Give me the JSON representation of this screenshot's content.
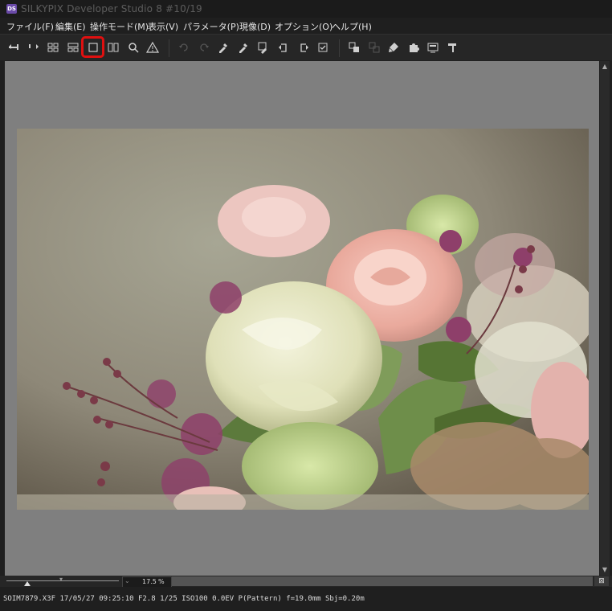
{
  "window": {
    "app_icon_label": "DS",
    "title": "SILKYPIX Developer Studio 8   #10/19"
  },
  "menu": [
    {
      "label": "ファイル(F)"
    },
    {
      "label": "編集(E)"
    },
    {
      "label": "操作モード(M)"
    },
    {
      "label": "表示(V)"
    },
    {
      "label": "パラメータ(P)"
    },
    {
      "label": "現像(D)"
    },
    {
      "label": "オプション(O)"
    },
    {
      "label": "ヘルプ(H)"
    }
  ],
  "toolbar": {
    "highlighted_tool": "single-image-view-button",
    "tools": [
      {
        "name": "prev-image-button",
        "icon": "arrow-left-icon"
      },
      {
        "name": "next-image-button",
        "icon": "arrow-right-icon"
      },
      {
        "name": "thumbnail-view-button",
        "icon": "grid-icon"
      },
      {
        "name": "thumbnail-list-button",
        "icon": "list-grid-icon"
      },
      {
        "name": "single-image-view-button",
        "icon": "single-frame-icon"
      },
      {
        "name": "compare-view-button",
        "icon": "dual-frame-icon"
      },
      {
        "name": "zoom-button",
        "icon": "magnifier-icon"
      },
      {
        "name": "highlight-warning-button",
        "icon": "warning-icon"
      },
      {
        "name": "undo-button",
        "icon": "undo-icon"
      },
      {
        "name": "redo-button",
        "icon": "redo-icon"
      },
      {
        "name": "white-balance-dropper-button",
        "icon": "dropper-icon"
      },
      {
        "name": "gray-balance-dropper-button",
        "icon": "dropper-icon"
      },
      {
        "name": "skin-dropper-button",
        "icon": "dropper-icon"
      },
      {
        "name": "rotate-left-button",
        "icon": "rotate-left-icon"
      },
      {
        "name": "rotate-right-button",
        "icon": "rotate-right-icon"
      },
      {
        "name": "mark-button",
        "icon": "checkbox-icon"
      },
      {
        "name": "copy-parameter-button",
        "icon": "copy-icon"
      },
      {
        "name": "paste-parameter-button",
        "icon": "paste-icon"
      },
      {
        "name": "spot-removal-button",
        "icon": "brush-icon"
      },
      {
        "name": "plugin-button",
        "icon": "puzzle-icon"
      },
      {
        "name": "develop-button",
        "icon": "monitor-icon"
      },
      {
        "name": "tools-button",
        "icon": "hammer-icon"
      }
    ]
  },
  "zoom": {
    "value": "17.5",
    "unit": "%"
  },
  "status_bar": {
    "text": "SOIM7879.X3F 17/05/27 09:25:10 F2.8 1/25 ISO100  0.0EV P(Pattern) f=19.0mm Sbj=0.20m"
  },
  "colors": {
    "highlight": "#e01010",
    "viewer_bg": "#7f7f7f",
    "chrome_bg": "#1f1f1f"
  }
}
